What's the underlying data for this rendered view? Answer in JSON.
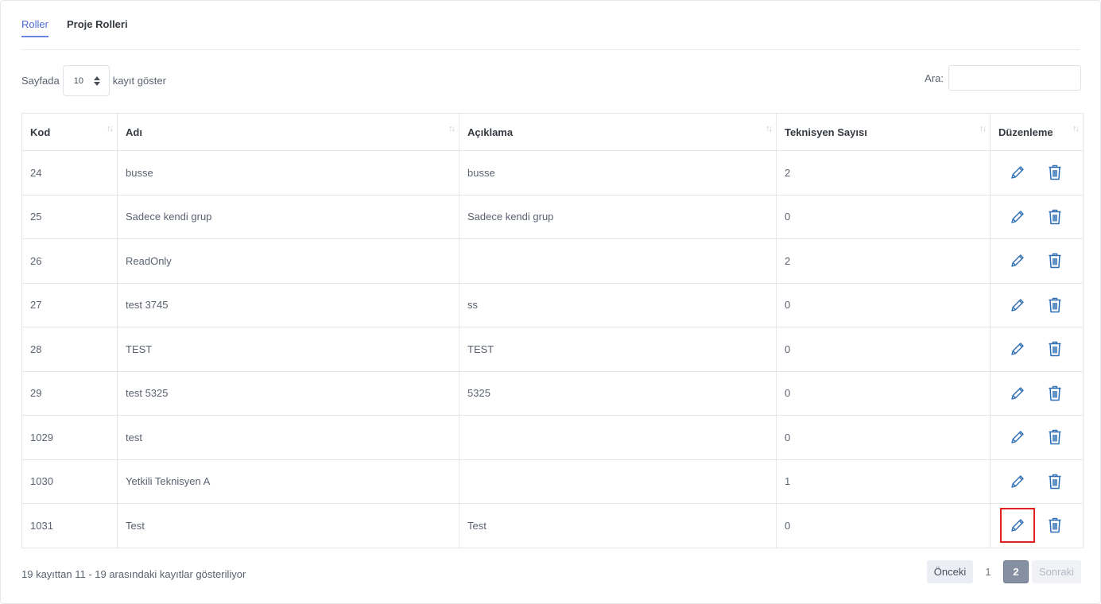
{
  "tabs": [
    {
      "label": "Roller",
      "active": true
    },
    {
      "label": "Proje Rolleri",
      "active": false
    }
  ],
  "length": {
    "prefix": "Sayfada",
    "value": "10",
    "suffix": "kayıt göster"
  },
  "search": {
    "label": "Ara:",
    "value": ""
  },
  "table": {
    "columns": [
      "Kod",
      "Adı",
      "Açıklama",
      "Teknisyen Sayısı",
      "Düzenleme"
    ],
    "rows": [
      {
        "kod": "24",
        "adi": "busse",
        "aciklama": "busse",
        "teknisyen": "2"
      },
      {
        "kod": "25",
        "adi": "Sadece kendi grup",
        "aciklama": "Sadece kendi grup",
        "teknisyen": "0"
      },
      {
        "kod": "26",
        "adi": "ReadOnly",
        "aciklama": "",
        "teknisyen": "2"
      },
      {
        "kod": "27",
        "adi": "test 3745",
        "aciklama": "ss",
        "teknisyen": "0"
      },
      {
        "kod": "28",
        "adi": "TEST",
        "aciklama": "TEST",
        "teknisyen": "0"
      },
      {
        "kod": "29",
        "adi": "test 5325",
        "aciklama": "5325",
        "teknisyen": "0"
      },
      {
        "kod": "1029",
        "adi": "test",
        "aciklama": "",
        "teknisyen": "0"
      },
      {
        "kod": "1030",
        "adi": "Yetkili Teknisyen A",
        "aciklama": "",
        "teknisyen": "1"
      },
      {
        "kod": "1031",
        "adi": "Test",
        "aciklama": "Test",
        "teknisyen": "0"
      }
    ],
    "sort_icon": "sort-arrows-icon",
    "edit_icon": "pencil-icon",
    "delete_icon": "trash-icon"
  },
  "info": "19 kayıttan 11 - 19 arasındaki kayıtlar gösteriliyor",
  "pagination": {
    "prev": "Önceki",
    "pages": [
      "1",
      "2"
    ],
    "current": "2",
    "next": "Sonraki"
  },
  "colors": {
    "accent": "#4f6bd8",
    "icon": "#2e6fb3",
    "highlight": "#e02222",
    "pager_active": "#8590a2"
  }
}
